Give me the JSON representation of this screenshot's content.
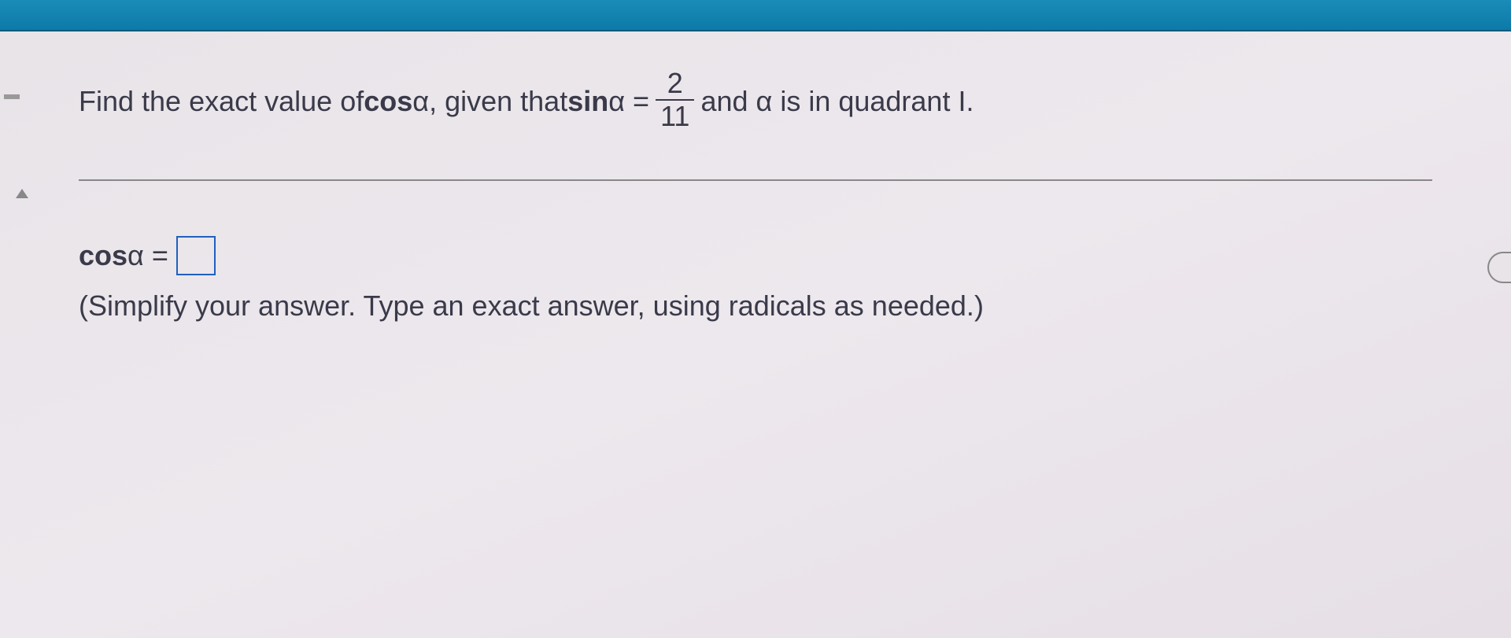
{
  "header": {},
  "question": {
    "part1": "Find the exact value of ",
    "cos_label": "cos",
    "alpha1": " α, given that ",
    "sin_label": "sin",
    "alpha2": " α = ",
    "fraction_num": "2",
    "fraction_den": "11",
    "part2": " and α is in quadrant I."
  },
  "answer": {
    "cos_label": "cos",
    "alpha_eq": " α = ",
    "input_value": "",
    "instruction": "(Simplify your answer. Type an exact answer, using radicals as needed.)"
  }
}
